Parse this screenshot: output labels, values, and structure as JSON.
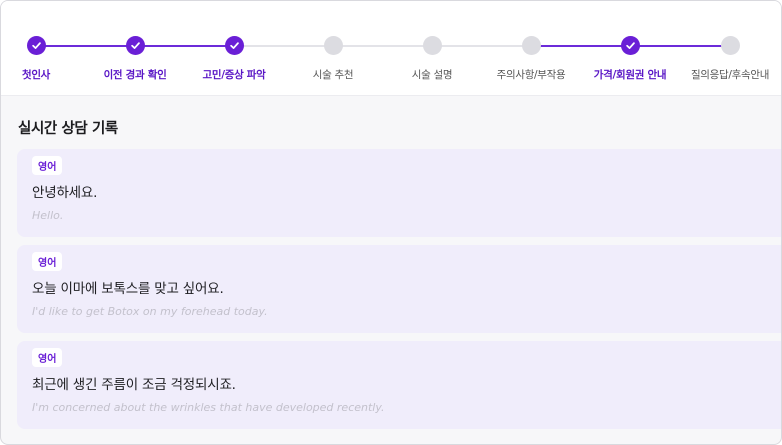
{
  "stepper": {
    "steps": [
      {
        "label": "첫인사",
        "done": true
      },
      {
        "label": "이전 경과 확인",
        "done": true
      },
      {
        "label": "고민/증상 파악",
        "done": true
      },
      {
        "label": "시술 추천",
        "done": false
      },
      {
        "label": "시술 설명",
        "done": false
      },
      {
        "label": "주의사항/부작용",
        "done": false
      },
      {
        "label": "가격/회원권 안내",
        "done": true
      },
      {
        "label": "질의응답/후속안내",
        "done": false
      }
    ],
    "accent": "#6a1fd6",
    "inactive_color": "#dcdce1"
  },
  "transcript": {
    "title": "실시간 상담 기록",
    "messages": [
      {
        "lang": "영어",
        "text": "안녕하세요.",
        "translation": "Hello."
      },
      {
        "lang": "영어",
        "text": "오늘 이마에 보톡스를 맞고 싶어요.",
        "translation": "I'd like to get Botox on my forehead today."
      },
      {
        "lang": "영어",
        "text": "최근에 생긴 주름이 조금 걱정되시죠.",
        "translation": "I'm concerned about the wrinkles that have developed recently."
      }
    ]
  }
}
